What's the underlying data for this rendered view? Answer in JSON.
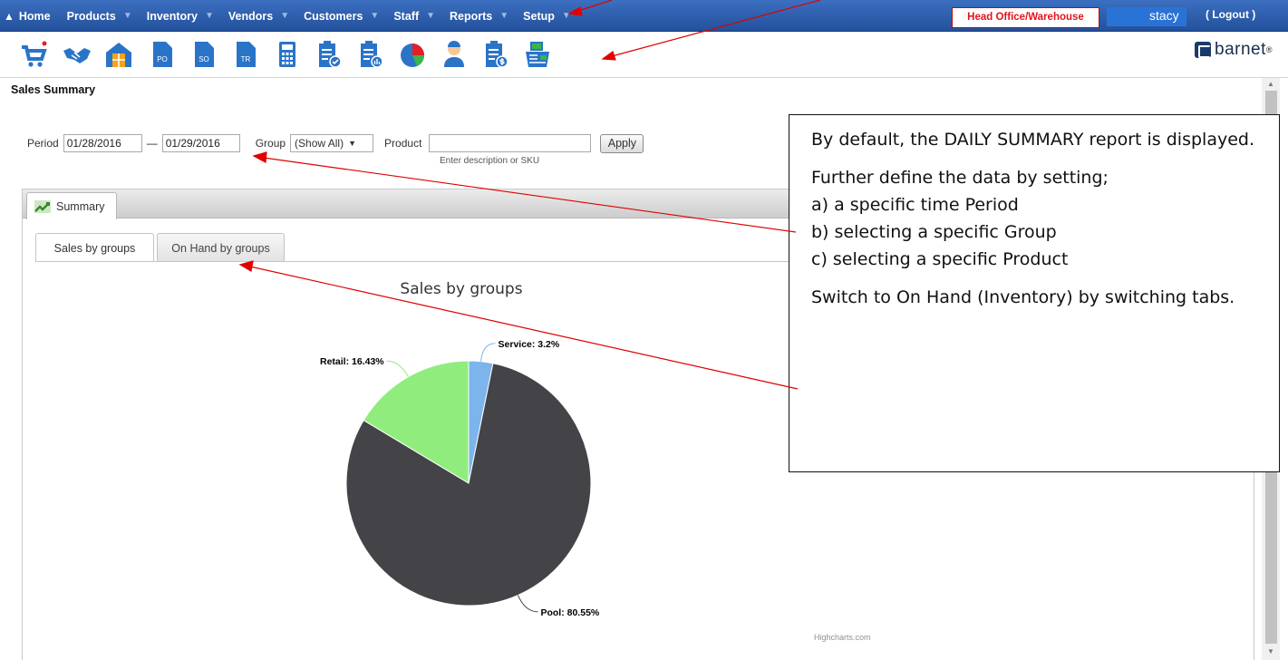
{
  "nav": {
    "home": "Home",
    "items": [
      "Products",
      "Inventory",
      "Vendors",
      "Customers",
      "Staff",
      "Reports",
      "Setup"
    ],
    "store": "Head Office/Warehouse",
    "user": "stacy",
    "logout": "( Logout )"
  },
  "toolbar": {
    "icons": [
      "cart-icon",
      "handshake-icon",
      "warehouse-icon",
      "purchase-order-icon",
      "sales-order-icon",
      "transfer-icon",
      "calculator-icon",
      "checklist-icon",
      "clipboard-stats-icon",
      "pie-chart-icon",
      "staff-icon",
      "clipboard-dollar-icon",
      "register-icon"
    ],
    "doc_labels": {
      "po": "PO",
      "so": "SO",
      "tr": "TR"
    },
    "brand": "barnet",
    "brand_mark": "®"
  },
  "page": {
    "title": "Sales Summary"
  },
  "filters": {
    "period_label": "Period",
    "period_from": "01/28/2016",
    "period_sep": "—",
    "period_to": "01/29/2016",
    "group_label": "Group",
    "group_value": "(Show All)",
    "product_label": "Product",
    "product_value": "",
    "product_hint": "Enter description or SKU",
    "apply": "Apply"
  },
  "panel": {
    "tab": "Summary",
    "sub_tabs": [
      "Sales by groups",
      "On Hand by groups"
    ],
    "active_sub_tab": 0
  },
  "chart_data": {
    "type": "pie",
    "title": "Sales by groups",
    "credit": "Highcharts.com",
    "slices": [
      {
        "name": "Service",
        "value": 3.2,
        "label": "Service: 3.2%",
        "color": "#7cb5ec"
      },
      {
        "name": "Pool",
        "value": 80.55,
        "label": "Pool: 80.55%",
        "color": "#434348"
      },
      {
        "name": "Retail",
        "value": 16.43,
        "label": "Retail: 16.43%",
        "color": "#90ed7d"
      }
    ]
  },
  "callout": {
    "para1": "By default, the DAILY SUMMARY report is displayed.",
    "para2": "Further define the data by setting;",
    "line_a": "a) a specific time Period",
    "line_b": "b) selecting a specific Group",
    "line_c": "c) selecting a specific Product",
    "para3": "Switch to On Hand (Inventory) by switching tabs."
  },
  "colors": {
    "nav": "#2b5ba8",
    "store_text": "#e4141b",
    "arrow": "#e00000"
  }
}
